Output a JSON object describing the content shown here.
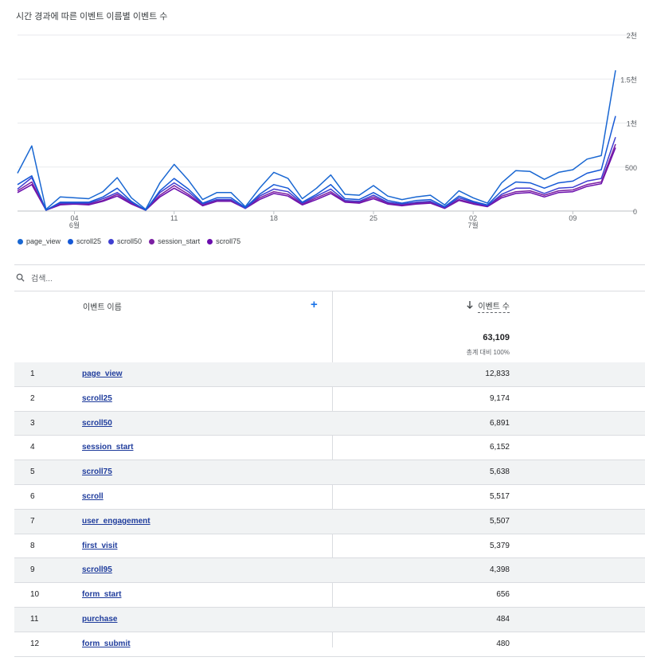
{
  "chart": {
    "title": "시간 경과에 따른 이벤트 이름별 이벤트 수"
  },
  "chart_data": {
    "type": "line",
    "ylim": [
      0,
      2000
    ],
    "y_ticks": [
      {
        "v": 0,
        "label": "0"
      },
      {
        "v": 500,
        "label": "500"
      },
      {
        "v": 1000,
        "label": "1천"
      },
      {
        "v": 1500,
        "label": "1.5천"
      },
      {
        "v": 2000,
        "label": "2천"
      }
    ],
    "x_ticks": [
      {
        "i": 4,
        "label": "04",
        "sub": "6월"
      },
      {
        "i": 11,
        "label": "11",
        "sub": ""
      },
      {
        "i": 18,
        "label": "18",
        "sub": ""
      },
      {
        "i": 25,
        "label": "25",
        "sub": ""
      },
      {
        "i": 32,
        "label": "02",
        "sub": "7월"
      },
      {
        "i": 39,
        "label": "09",
        "sub": ""
      }
    ],
    "x_count": 44,
    "grid": true,
    "legend_position": "bottom-left",
    "series": [
      {
        "name": "page_view",
        "color": "#1967d2",
        "values": [
          430,
          740,
          20,
          160,
          150,
          140,
          220,
          380,
          150,
          20,
          320,
          530,
          350,
          130,
          210,
          210,
          50,
          260,
          440,
          370,
          140,
          260,
          410,
          190,
          180,
          290,
          170,
          130,
          160,
          180,
          70,
          230,
          150,
          90,
          320,
          460,
          450,
          360,
          440,
          470,
          590,
          630,
          1600
        ]
      },
      {
        "name": "scroll25",
        "color": "#1558d6",
        "values": [
          300,
          400,
          10,
          100,
          100,
          100,
          160,
          260,
          110,
          10,
          230,
          370,
          250,
          90,
          150,
          150,
          40,
          190,
          300,
          260,
          100,
          190,
          300,
          140,
          130,
          210,
          120,
          90,
          120,
          130,
          50,
          170,
          110,
          70,
          230,
          330,
          320,
          260,
          320,
          340,
          430,
          470,
          1080
        ]
      },
      {
        "name": "scroll50",
        "color": "#3f3fd1",
        "values": [
          250,
          380,
          10,
          90,
          90,
          90,
          140,
          210,
          100,
          10,
          210,
          320,
          220,
          80,
          130,
          130,
          30,
          170,
          250,
          220,
          90,
          170,
          250,
          120,
          110,
          180,
          100,
          80,
          100,
          110,
          40,
          150,
          100,
          60,
          190,
          260,
          260,
          200,
          260,
          270,
          340,
          370,
          840
        ]
      },
      {
        "name": "session_start",
        "color": "#7b1fa2",
        "values": [
          230,
          330,
          10,
          80,
          90,
          80,
          120,
          190,
          90,
          10,
          180,
          290,
          190,
          70,
          120,
          120,
          30,
          150,
          220,
          190,
          80,
          150,
          220,
          110,
          100,
          160,
          90,
          70,
          90,
          100,
          40,
          130,
          90,
          60,
          170,
          220,
          230,
          180,
          230,
          240,
          300,
          330,
          760
        ]
      },
      {
        "name": "scroll75",
        "color": "#6a0dad",
        "values": [
          210,
          300,
          10,
          70,
          80,
          70,
          110,
          170,
          80,
          10,
          160,
          260,
          170,
          60,
          110,
          110,
          30,
          130,
          200,
          170,
          70,
          130,
          200,
          100,
          90,
          140,
          80,
          60,
          80,
          90,
          30,
          120,
          80,
          50,
          150,
          200,
          210,
          160,
          210,
          220,
          280,
          310,
          720
        ]
      }
    ]
  },
  "search": {
    "placeholder": "검색..."
  },
  "table": {
    "col_name": "이벤트 이름",
    "col_metric": "이벤트 수",
    "total": "63,109",
    "total_pct": "총계 대비 100%",
    "rows": [
      {
        "idx": "1",
        "name": "page_view",
        "value": "12,833"
      },
      {
        "idx": "2",
        "name": "scroll25",
        "value": "9,174"
      },
      {
        "idx": "3",
        "name": "scroll50",
        "value": "6,891"
      },
      {
        "idx": "4",
        "name": "session_start",
        "value": "6,152"
      },
      {
        "idx": "5",
        "name": "scroll75",
        "value": "5,638"
      },
      {
        "idx": "6",
        "name": "scroll",
        "value": "5,517"
      },
      {
        "idx": "7",
        "name": "user_engagement",
        "value": "5,507"
      },
      {
        "idx": "8",
        "name": "first_visit",
        "value": "5,379"
      },
      {
        "idx": "9",
        "name": "scroll95",
        "value": "4,398"
      },
      {
        "idx": "10",
        "name": "form_start",
        "value": "656"
      },
      {
        "idx": "11",
        "name": "purchase",
        "value": "484"
      },
      {
        "idx": "12",
        "name": "form_submit",
        "value": "480"
      }
    ]
  }
}
